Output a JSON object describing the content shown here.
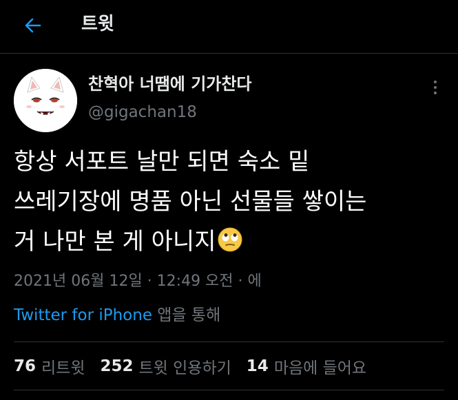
{
  "header": {
    "title": "트윗",
    "back_icon": "arrow-left-icon",
    "accent_color": "#1d9bf0"
  },
  "author": {
    "display_name": "찬혁아 너땜에 기가찬다",
    "handle": "@gigachan18",
    "avatar_icon": "white-cat-avatar"
  },
  "tweet": {
    "lines": [
      "항상 서포트 날만 되면 숙소 밑",
      "쓰레기장에 명품 아닌 선물들 쌓이는",
      "거 나만 본 게 아니지"
    ],
    "emoji": "face-with-rolling-eyes-emoji",
    "timestamp": "2021년 06월 12일 · 12:49 오전 · 에",
    "source_link": "Twitter for iPhone",
    "source_suffix": " 앱을 통해"
  },
  "stats": {
    "retweets_count": "76",
    "retweets_label": "리트윗",
    "quotes_count": "252",
    "quotes_label": "트윗 인용하기",
    "likes_count": "14",
    "likes_label": "마음에 들어요"
  }
}
